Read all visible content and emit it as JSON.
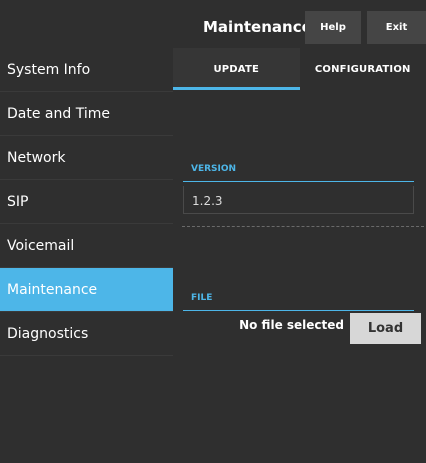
{
  "header": {
    "title": "Maintenance",
    "help_label": "Help",
    "exit_label": "Exit"
  },
  "sidebar": {
    "items": [
      {
        "label": "System Info",
        "active": false
      },
      {
        "label": "Date and Time",
        "active": false
      },
      {
        "label": "Network",
        "active": false
      },
      {
        "label": "SIP",
        "active": false
      },
      {
        "label": "Voicemail",
        "active": false
      },
      {
        "label": "Maintenance",
        "active": true
      },
      {
        "label": "Diagnostics",
        "active": false
      }
    ]
  },
  "tabs": [
    {
      "label": "UPDATE",
      "active": true
    },
    {
      "label": "CONFIGURATION",
      "active": false
    }
  ],
  "update": {
    "version_label": "VERSION",
    "version_value": "1.2.3",
    "file_label": "FILE",
    "file_status": "No file selected",
    "load_label": "Load"
  },
  "colors": {
    "background": "#2f2f2f",
    "accent": "#4db6e8",
    "button": "#454545",
    "load_button": "#d7d7d7"
  }
}
